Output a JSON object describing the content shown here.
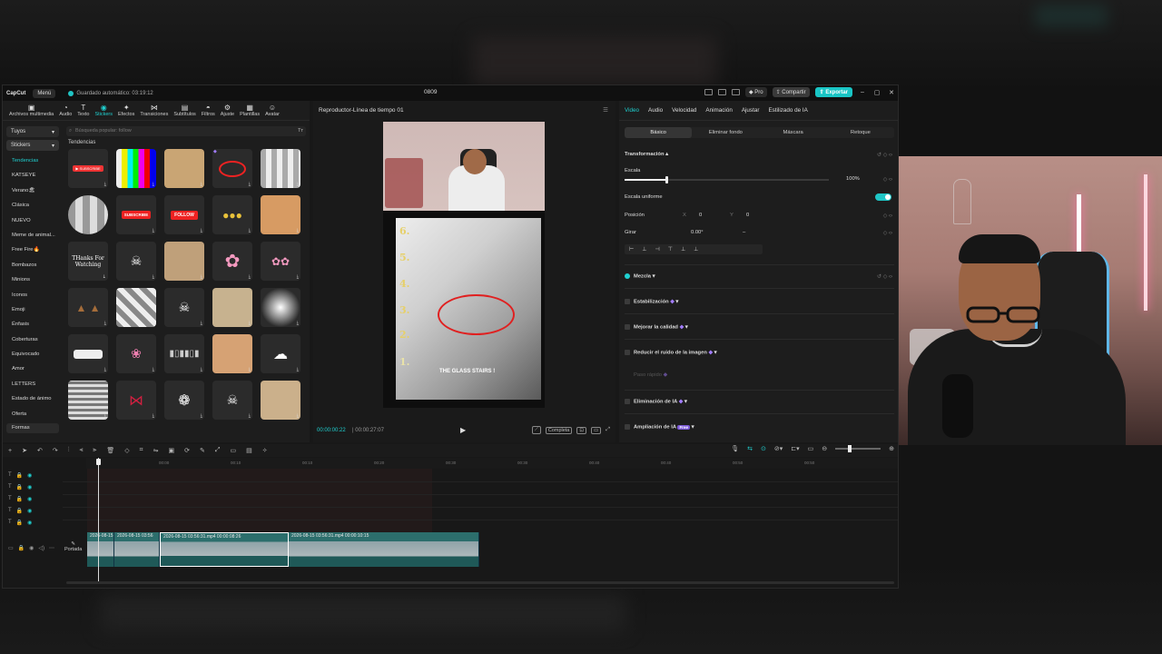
{
  "app": {
    "logo": "CapCut",
    "menu_label": "Menú",
    "autosave": "Guardado automático: 03:19:12",
    "project_title": "0809",
    "pro_label": "Pro",
    "share_label": "Compartir",
    "export_label": "Exportar",
    "accent_color": "#1fd0d0"
  },
  "toolbar": {
    "tools": [
      {
        "label": "Archivos multimedia",
        "icon": "media-icon"
      },
      {
        "label": "Audio",
        "icon": "audio-icon"
      },
      {
        "label": "Texto",
        "icon": "text-icon"
      },
      {
        "label": "Stickers",
        "icon": "sticker-icon",
        "active": true
      },
      {
        "label": "Efectos",
        "icon": "effects-icon"
      },
      {
        "label": "Transiciones",
        "icon": "transitions-icon"
      },
      {
        "label": "Subtítulos",
        "icon": "captions-icon"
      },
      {
        "label": "Filtros",
        "icon": "filters-icon"
      },
      {
        "label": "Ajuste",
        "icon": "adjust-icon"
      },
      {
        "label": "Plantillas",
        "icon": "templates-icon"
      },
      {
        "label": "Avatar",
        "icon": "avatar-icon"
      }
    ]
  },
  "categories": {
    "dropdown1": "Tuyos",
    "dropdown2": "Stickers",
    "items": [
      "Tendencias",
      "KATSEYE",
      "Verano🏖",
      "Clásica",
      "NUEVO",
      "Meme de animal...",
      "Free Fire🔥",
      "Bombazos",
      "Minions",
      "Iconos",
      "Emoji",
      "Énfasis",
      "Coberturas",
      "Equivocado",
      "Amor",
      "LETTERS",
      "Estado de ánimo",
      "Oferta"
    ],
    "formas": "Formas"
  },
  "stickers": {
    "search_placeholder": "Búsqueda popular: follow",
    "section_title": "Tendencias",
    "subscribe_text": "SUBSCRIBE",
    "follow_text": "FOLLOW",
    "thanks_text": "THanks For Watching"
  },
  "player": {
    "title": "Reproductor-Línea de tiempo 01",
    "time_current": "00:00:00:22",
    "time_total": "00:00:27:07",
    "ratio_label": "Completa",
    "video_caption": "THE GLASS STAIRS !",
    "step_numbers": [
      "6.",
      "5.",
      "4.",
      "3.",
      "2.",
      "1."
    ]
  },
  "inspector": {
    "tabs": [
      "Video",
      "Audio",
      "Velocidad",
      "Animación",
      "Ajustar",
      "Estilizado de IA"
    ],
    "subtabs": [
      "Básico",
      "Eliminar fondo",
      "Máscara",
      "Retoque"
    ],
    "transformacion": "Transformación",
    "escala_label": "Escala",
    "escala_value": "100%",
    "escala_fraction": 0.2,
    "escala_uniforme": "Escala uniforme",
    "posicion_label": "Posición",
    "pos_x_label": "X",
    "pos_x": "0",
    "pos_y_label": "Y",
    "pos_y": "0",
    "girar_label": "Girar",
    "girar_value": "0.00°",
    "girar_dash": "–",
    "mezcla": "Mezcla",
    "estabilizacion": "Estabilización",
    "mejorar_calidad": "Mejorar la calidad",
    "reducir_ruido": "Reducir el ruido de la imagen",
    "paso_rapido": "Paso rápido",
    "eliminacion_ia": "Eliminación de IA",
    "ampliacion_ia": "Ampliación de IA",
    "free_badge": "Free"
  },
  "timeline": {
    "ruler_ticks": [
      "00:00",
      "00:10",
      "00:10",
      "00:20",
      "00:30",
      "00:30",
      "00:40",
      "00:40",
      "00:50",
      "00:50"
    ],
    "portada_label": "Portada",
    "clips": [
      {
        "label": "2026-08-15"
      },
      {
        "label": "2026-08-15 03:56"
      },
      {
        "label": "2026-08-15 03:56:31.mp4  00:00:08:26"
      },
      {
        "label": "2026-08-15 03:56:31.mp4  00:00:10:15"
      }
    ]
  }
}
